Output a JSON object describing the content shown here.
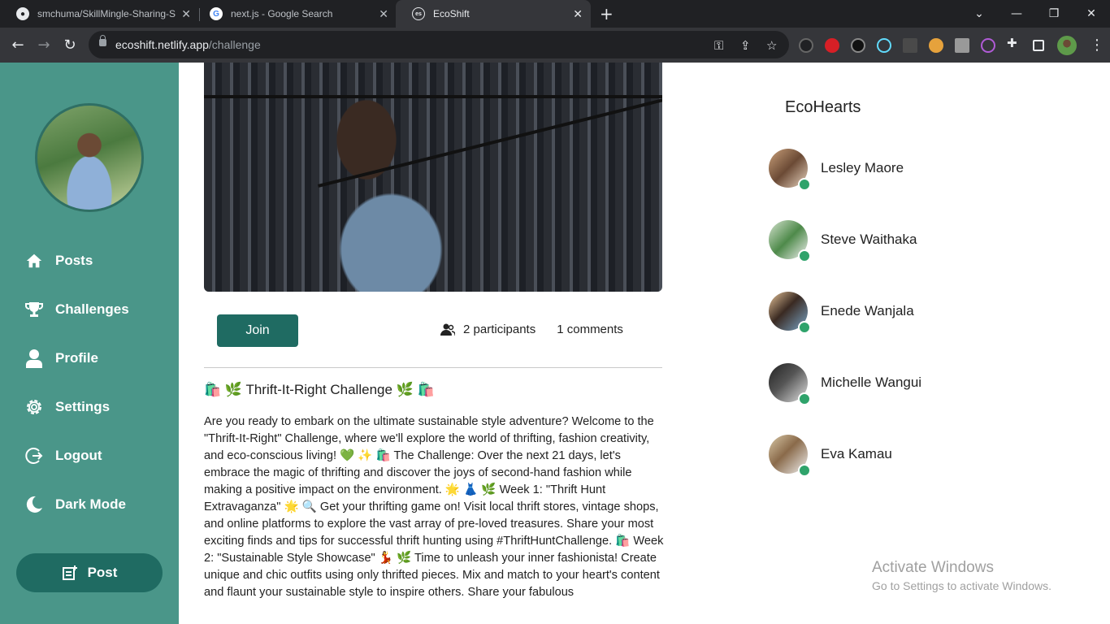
{
  "browser": {
    "tabs": [
      {
        "title": "smchuma/SkillMingle-Sharing-S",
        "icon": "github-icon"
      },
      {
        "title": "next.js - Google Search",
        "icon": "google-icon"
      },
      {
        "title": "EcoShift",
        "icon": "ecoshift-icon"
      }
    ],
    "address": {
      "host": "ecoshift.netlify.app",
      "path": "/challenge"
    }
  },
  "sidebar": {
    "items": [
      {
        "label": "Posts",
        "icon": "home-icon"
      },
      {
        "label": "Challenges",
        "icon": "trophy-icon"
      },
      {
        "label": "Profile",
        "icon": "user-icon"
      },
      {
        "label": "Settings",
        "icon": "gear-icon"
      },
      {
        "label": "Logout",
        "icon": "logout-icon"
      },
      {
        "label": "Dark Mode",
        "icon": "moon-icon"
      }
    ],
    "post_label": "Post"
  },
  "challenge": {
    "join_label": "Join",
    "participants": "2 participants",
    "comments": "1 comments",
    "title": "🛍️ 🌿 Thrift-It-Right Challenge 🌿 🛍️",
    "body": "Are you ready to embark on the ultimate sustainable style adventure? Welcome to the \"Thrift-It-Right\" Challenge, where we'll explore the world of thrifting, fashion creativity, and eco-conscious living! 💚 ✨ 🛍️ The Challenge: Over the next 21 days, let's embrace the magic of thrifting and discover the joys of second-hand fashion while making a positive impact on the environment. 🌟 👗 🌿 Week 1: \"Thrift Hunt Extravaganza\" 🌟 🔍 Get your thrifting game on! Visit local thrift stores, vintage shops, and online platforms to explore the vast array of pre-loved treasures. Share your most exciting finds and tips for successful thrift hunting using #ThriftHuntChallenge. 🛍️ Week 2: \"Sustainable Style Showcase\" 💃 🌿 Time to unleash your inner fashionista! Create unique and chic outfits using only thrifted pieces. Mix and match to your heart's content and flaunt your sustainable style to inspire others. Share your fabulous"
  },
  "ecohearts": {
    "title": "EcoHearts",
    "people": [
      {
        "name": "Lesley Maore"
      },
      {
        "name": "Steve Waithaka"
      },
      {
        "name": "Enede Wanjala"
      },
      {
        "name": "Michelle Wangui"
      },
      {
        "name": "Eva Kamau"
      }
    ]
  },
  "watermark": {
    "line1": "Activate Windows",
    "line2": "Go to Settings to activate Windows."
  },
  "colors": {
    "sidebar": "#4a9689",
    "accent": "#1f6b62",
    "online": "#2fa36b"
  }
}
